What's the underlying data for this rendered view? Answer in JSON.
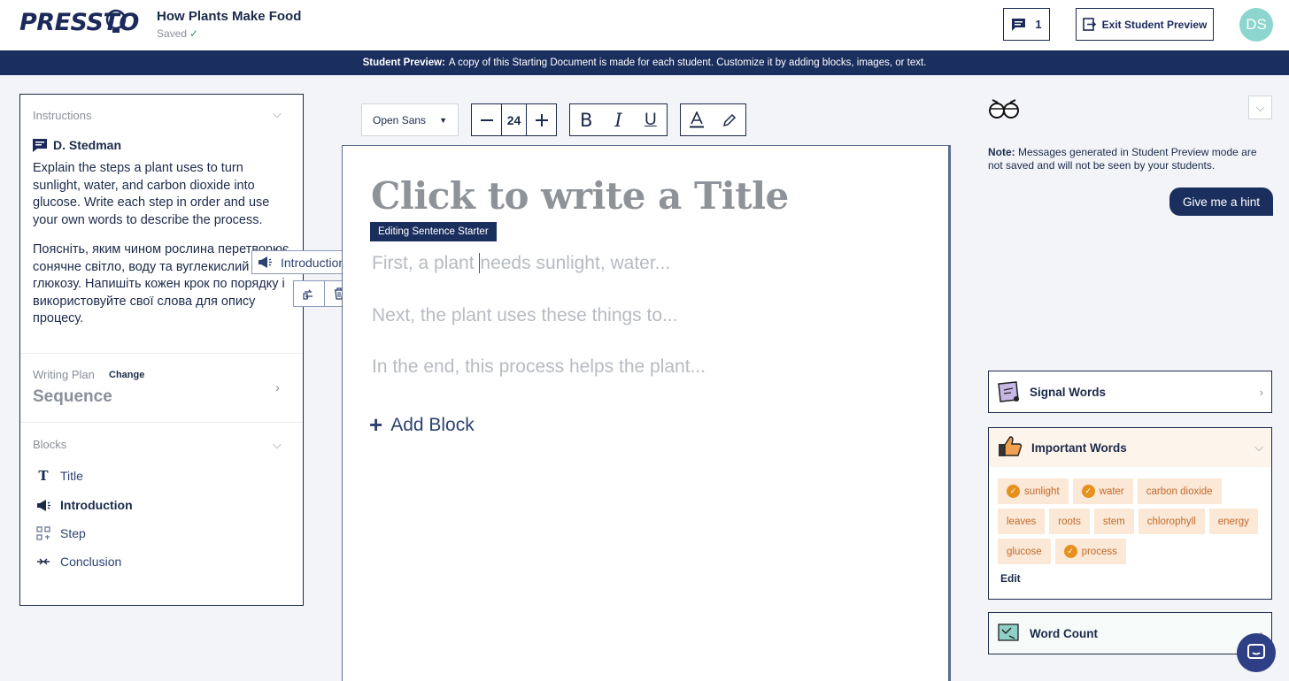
{
  "header": {
    "logo": "PRESSTO",
    "doc_title": "How Plants Make Food",
    "saved_status": "Saved",
    "comment_count": "1",
    "exit_label": "Exit Student Preview",
    "avatar_initials": "DS"
  },
  "banner": {
    "bold": "Student Preview:",
    "text": "A copy of this Starting Document is made for each student. Customize it by adding blocks, images, or text."
  },
  "left": {
    "instructions_label": "Instructions",
    "teacher": "D. Stedman",
    "instructions_en": "Explain the steps a plant uses to turn sunlight, water, and carbon dioxide into glucose. Write each step in order and use your own words to describe the process.",
    "instructions_uk": "Поясніть, яким чином рослина перетворює сонячне світло, воду та вуглекислий газ на глюкозу. Напишіть кожен крок по порядку і використовуйте свої слова для опису процесу.",
    "writing_plan_label": "Writing Plan",
    "change_label": "Change",
    "writing_plan_value": "Sequence",
    "blocks_label": "Blocks",
    "blocks": [
      {
        "label": "Title",
        "icon": "title-icon"
      },
      {
        "label": "Introduction",
        "icon": "megaphone-icon"
      },
      {
        "label": "Step",
        "icon": "steps-icon"
      },
      {
        "label": "Conclusion",
        "icon": "conclusion-icon"
      }
    ]
  },
  "floating": {
    "block_type": "Introduction"
  },
  "toolbar": {
    "font": "Open Sans",
    "font_size": "24"
  },
  "editor": {
    "title_placeholder": "Click to write a Title",
    "starter_tag": "Editing Sentence Starter",
    "line1_a": "First, a plant ",
    "line1_b": "needs sunlight, water...",
    "line2": "Next, the plant uses these things to...",
    "line3": "In the end, this process helps the plant...",
    "add_block": "Add Block"
  },
  "right": {
    "note_bold": "Note:",
    "note_text": "Messages generated in Student Preview mode are not saved and will not be seen by your students.",
    "hint_button": "Give me a hint",
    "signal_words": "Signal Words",
    "important_words": "Important Words",
    "words": [
      {
        "text": "sunlight",
        "checked": true
      },
      {
        "text": "water",
        "checked": true
      },
      {
        "text": "carbon dioxide",
        "checked": false
      },
      {
        "text": "leaves",
        "checked": false
      },
      {
        "text": "roots",
        "checked": false
      },
      {
        "text": "stem",
        "checked": false
      },
      {
        "text": "chlorophyll",
        "checked": false
      },
      {
        "text": "energy",
        "checked": false
      },
      {
        "text": "glucose",
        "checked": false
      },
      {
        "text": "process",
        "checked": true
      }
    ],
    "edit_label": "Edit",
    "word_count": "Word Count"
  },
  "colors": {
    "navy": "#1b2f5e",
    "avatar": "#8dd5cf",
    "word_bg": "#fce8d6",
    "word_text": "#c06a2c",
    "check": "#e6911e"
  }
}
